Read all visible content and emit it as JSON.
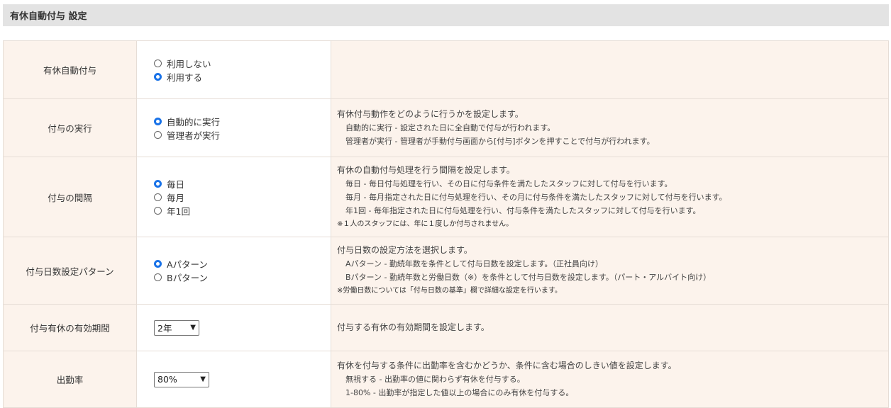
{
  "header": {
    "title": "有休自動付与 設定"
  },
  "rows": {
    "auto_grant": {
      "label": "有休自動付与",
      "options": [
        "利用しない",
        "利用する"
      ],
      "selected": 1
    },
    "execution": {
      "label": "付与の実行",
      "options": [
        "自動的に実行",
        "管理者が実行"
      ],
      "selected": 0,
      "desc": "有休付与動作をどのように行うかを設定します。",
      "sub": [
        "自動的に実行 - 設定された日に全自動で付与が行われます。",
        "管理者が実行 - 管理者が手動付与画面から[付与]ボタンを押すことで付与が行われます。"
      ]
    },
    "interval": {
      "label": "付与の間隔",
      "options": [
        "毎日",
        "毎月",
        "年1回"
      ],
      "selected": 0,
      "desc": "有休の自動付与処理を行う間隔を設定します。",
      "sub": [
        "毎日 - 毎日付与処理を行い、その日に付与条件を満たしたスタッフに対して付与を行います。",
        "毎月 - 毎月指定された日に付与処理を行い、その月に付与条件を満たしたスタッフに対して付与を行います。",
        "年1回 - 毎年指定された日に付与処理を行い、付与条件を満たしたスタッフに対して付与を行います。"
      ],
      "note": "※１人のスタッフには、年に１度しか付与されません。"
    },
    "pattern": {
      "label": "付与日数設定パターン",
      "options": [
        "Aパターン",
        "Bパターン"
      ],
      "selected": 0,
      "desc": "付与日数の設定方法を選択します。",
      "sub": [
        "Aパターン - 勤続年数を条件として付与日数を設定します。（正社員向け）",
        "Bパターン - 勤続年数と労働日数（※）を条件として付与日数を設定します。（パート・アルバイト向け）"
      ],
      "note": "※労働日数については「付与日数の基準」欄で詳細な設定を行います。"
    },
    "validity": {
      "label": "付与有休の有効期間",
      "select_value": "2年",
      "desc": "付与する有休の有効期間を設定します。"
    },
    "attendance": {
      "label": "出勤率",
      "select_value": "80%",
      "desc": "有休を付与する条件に出勤率を含むかどうか、条件に含む場合のしきい値を設定します。",
      "sub": [
        "無視する - 出勤率の値に関わらず有休を付与する。",
        "1-80% - 出勤率が指定した値以上の場合にのみ有休を付与する。"
      ]
    }
  }
}
